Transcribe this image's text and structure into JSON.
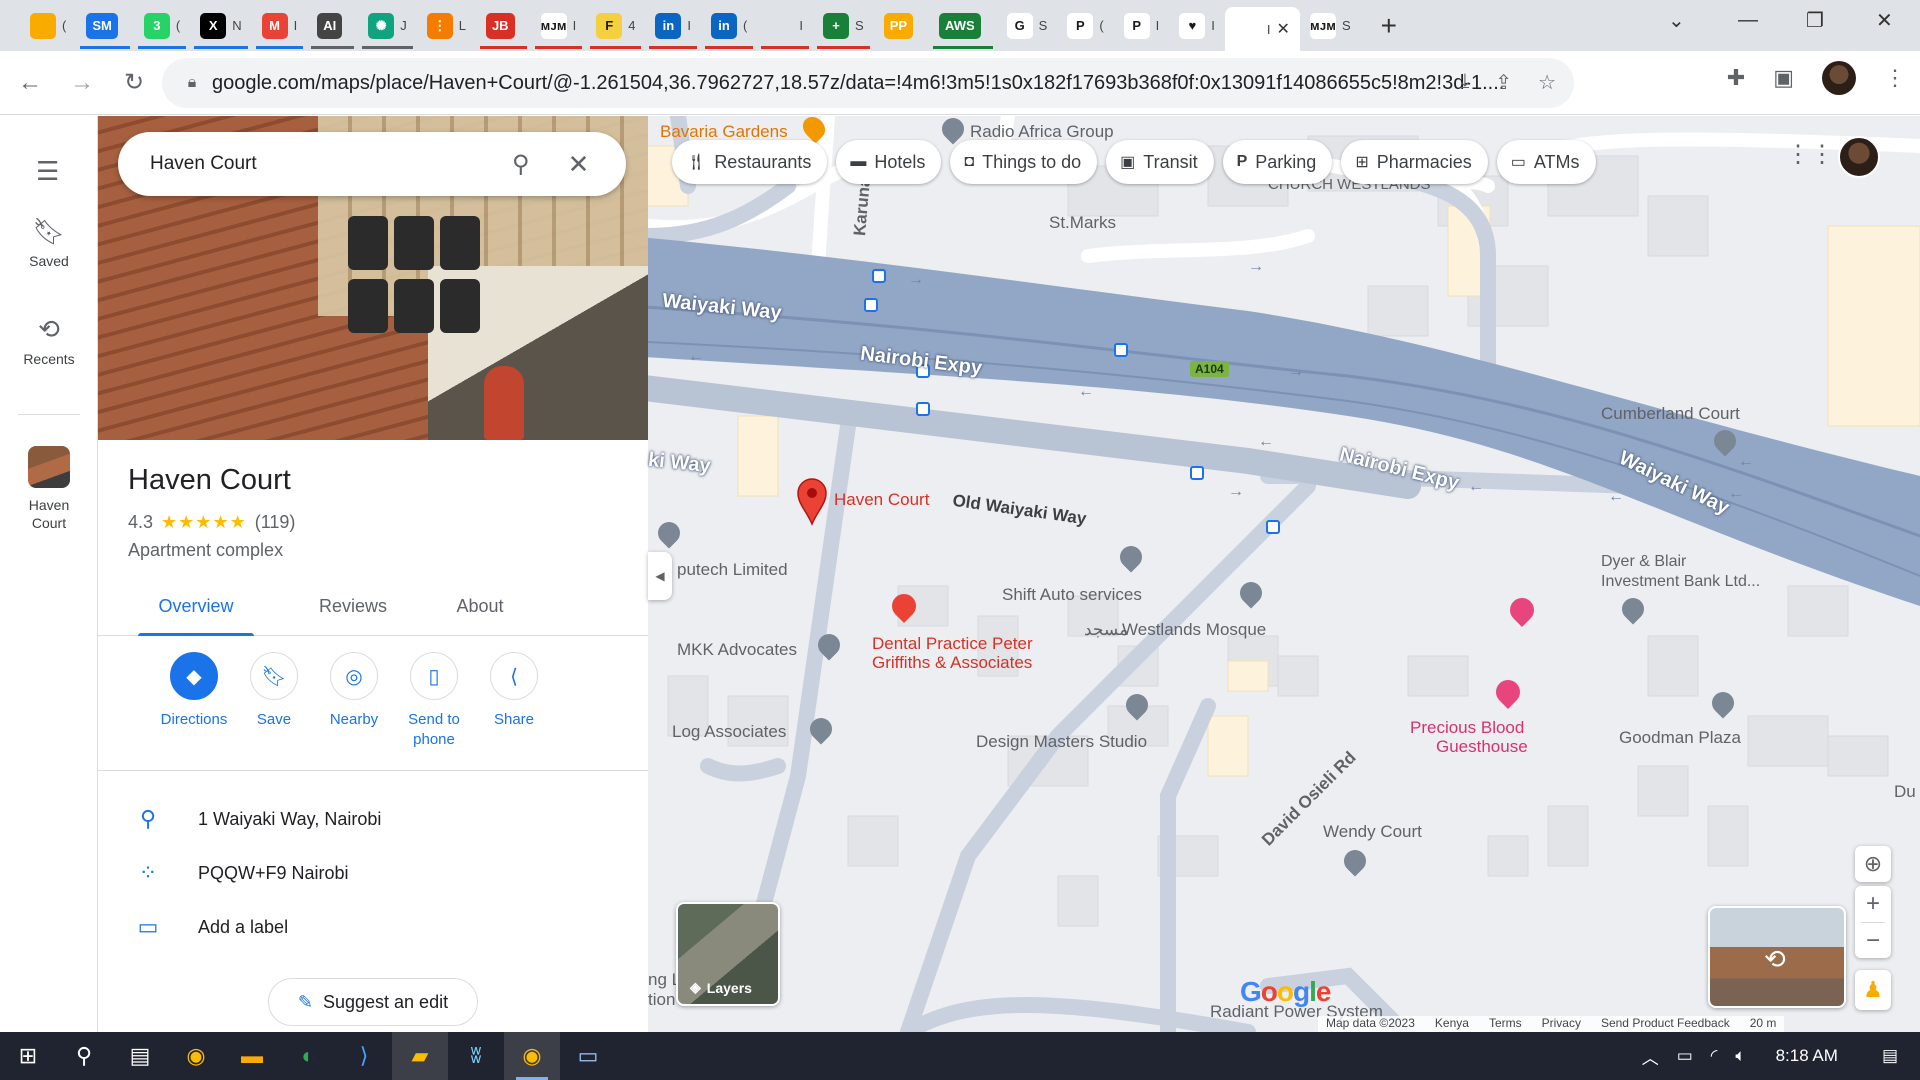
{
  "browser": {
    "tabs": [
      {
        "icon": "keep-icon",
        "title": "(",
        "color": "#f9ab00",
        "badge": ""
      },
      {
        "icon": "sm-icon",
        "title": "",
        "color": "#1a73e8",
        "badge": "SM"
      },
      {
        "icon": "whatsapp-icon",
        "title": "(",
        "color": "#25d366",
        "badge": "3"
      },
      {
        "icon": "x-icon",
        "title": "N",
        "color": "#000000",
        "badge": "X"
      },
      {
        "icon": "gmail-icon",
        "title": "I",
        "color": "#ea4335",
        "badge": "M"
      },
      {
        "icon": "ai-icon",
        "title": "",
        "color": "#444444",
        "badge": "AI"
      },
      {
        "icon": "chatgpt-icon",
        "title": "J",
        "color": "#10a37f",
        "badge": "✺"
      },
      {
        "icon": "orange-app-icon",
        "title": "L",
        "color": "#f57c00",
        "badge": "⋮"
      },
      {
        "icon": "jb-icon",
        "title": "",
        "color": "#d93025",
        "badge": "JB"
      },
      {
        "icon": "mjm-icon",
        "title": "I",
        "color": "#ffffff",
        "badge": "ᴍᴊᴍ"
      },
      {
        "icon": "f-icon",
        "title": "4",
        "color": "#f4d03f",
        "badge": "F"
      },
      {
        "icon": "linkedin-icon",
        "title": "I",
        "color": "#0a66c2",
        "badge": "in"
      },
      {
        "icon": "linkedin-icon",
        "title": "(",
        "color": "#0a66c2",
        "badge": "in"
      },
      {
        "icon": "blank-icon",
        "title": "I",
        "color": "#dfe3e8",
        "badge": ""
      },
      {
        "icon": "plus-app-icon",
        "title": "S",
        "color": "#188038",
        "badge": "+"
      },
      {
        "icon": "pp-icon",
        "title": "",
        "color": "#f9ab00",
        "badge": "PP"
      },
      {
        "icon": "aws-icon",
        "title": "",
        "color": "#188038",
        "badge": "AWS"
      },
      {
        "icon": "google-icon",
        "title": "S",
        "color": "#ffffff",
        "badge": "G"
      },
      {
        "icon": "paypal-icon",
        "title": "(",
        "color": "#ffffff",
        "badge": "P"
      },
      {
        "icon": "paypal-icon",
        "title": "I",
        "color": "#ffffff",
        "badge": "P"
      },
      {
        "icon": "heart-icon",
        "title": "I",
        "color": "#ffffff",
        "badge": "♥"
      },
      {
        "icon": "maps-tab-icon",
        "title": "I",
        "color": "#ffffff",
        "badge": ""
      },
      {
        "icon": "mjm-icon",
        "title": "S",
        "color": "#ffffff",
        "badge": "ᴍᴊᴍ"
      }
    ],
    "url": "google.com/maps/place/Haven+Court/@-1.261504,36.7962727,18.57z/data=!4m6!3m5!1s0x182f17693b368f0f:0x13091f14086655c5!8m2!3d-1...."
  },
  "rail": {
    "saved_label": "Saved",
    "recents_label": "Recents",
    "recent_place": "Haven Court"
  },
  "search": {
    "query": "Haven Court"
  },
  "place": {
    "name": "Haven Court",
    "rating": "4.3",
    "stars": "★★★★★",
    "review_count": "(119)",
    "category": "Apartment complex",
    "tabs": [
      "Overview",
      "Reviews",
      "About"
    ],
    "actions": [
      {
        "label": "Directions",
        "icon": "directions-icon"
      },
      {
        "label": "Save",
        "icon": "bookmark-icon"
      },
      {
        "label": "Nearby",
        "icon": "nearby-icon"
      },
      {
        "label": "Send to phone",
        "icon": "send-to-phone-icon"
      },
      {
        "label": "Share",
        "icon": "share-icon"
      }
    ],
    "address": "1 Waiyaki Way, Nairobi",
    "plus_code": "PQQW+F9 Nairobi",
    "add_label": "Add a label",
    "suggest_edit": "Suggest an edit"
  },
  "map": {
    "chips": [
      {
        "label": "Restaurants",
        "icon": "fork-knife-icon"
      },
      {
        "label": "Hotels",
        "icon": "bed-icon"
      },
      {
        "label": "Things to do",
        "icon": "camera-icon"
      },
      {
        "label": "Transit",
        "icon": "bus-icon"
      },
      {
        "label": "Parking",
        "icon": "parking-icon"
      },
      {
        "label": "Pharmacies",
        "icon": "pharmacy-icon"
      },
      {
        "label": "ATMs",
        "icon": "atm-icon"
      }
    ],
    "labels": {
      "bavaria": "Bavaria Gardens",
      "radio_africa": "Radio Africa Group",
      "st_marks": "St.Marks",
      "church": "CHURCH WESTLANDS",
      "karuna": "Karuna Cl",
      "waiyaki_1": "Waiyaki Way",
      "nairobi_expy_1": "Nairobi Expy",
      "hwy": "A104",
      "waiyaki_2": "ki Way",
      "haven_court": "Haven Court",
      "old_waiyaki": "Old Waiyaki Way",
      "nairobi_expy_2": "Nairobi Expy",
      "waiyaki_3": "Waiyaki Way",
      "cumberland": "Cumberland Court",
      "computech": "putech Limited",
      "shift_auto": "Shift Auto services",
      "mosque": "Westlands Mosque",
      "mosque_arabic": "مسجد",
      "dental": "Dental Practice Peter",
      "dental_2": "Griffiths & Associates",
      "mkk": "MKK Advocates",
      "dyer_1": "Dyer & Blair",
      "dyer_2": "Investment Bank Ltd...",
      "log_assoc": "Log Associates",
      "design_masters": "Design Masters Studio",
      "precious_1": "Precious Blood",
      "precious_2": "Guesthouse",
      "goodman": "Goodman Plaza",
      "david_osieli": "David Osieli Rd",
      "wendy": "Wendy Court",
      "radiant": "Radiant Power System",
      "edge_ng": "ng L",
      "edge_tion": "tion",
      "edge_du": "Du"
    },
    "layers_label": "Layers",
    "attribution": [
      "Map data ©2023",
      "Kenya",
      "Terms",
      "Privacy",
      "Send Product Feedback",
      "20 m"
    ],
    "logo": "Google"
  },
  "taskbar": {
    "time": "8:18 AM"
  }
}
